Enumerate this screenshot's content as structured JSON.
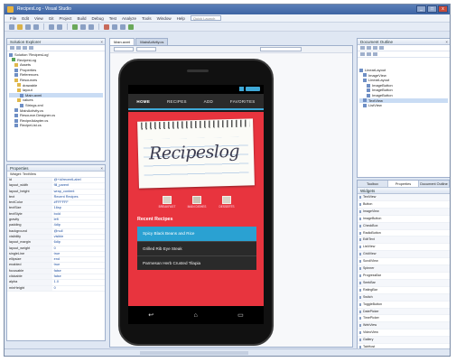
{
  "window": {
    "title": "RecipesLog - Visual Studio"
  },
  "menu": {
    "items": [
      "File",
      "Edit",
      "View",
      "Git",
      "Project",
      "Build",
      "Debug",
      "Test",
      "Analyze",
      "Tools",
      "Window",
      "Help"
    ],
    "quick_launch": "Quick Launch"
  },
  "solution_explorer": {
    "title": "Solution Explorer",
    "items": [
      "Solution 'RecipesLog'",
      "RecipesLog",
      "Assets",
      "Properties",
      "References",
      "Resources",
      "drawable",
      "layout",
      "Main.axml",
      "values",
      "Strings.xml",
      "MainActivity.cs",
      "Resource.Designer.cs",
      "RecipeAdapter.cs",
      "RecipeList.cs"
    ]
  },
  "properties": {
    "title": "Properties",
    "subtitle": "Widget: TextView",
    "rows": [
      [
        "id",
        "@+id/recentLabel"
      ],
      [
        "layout_width",
        "fill_parent"
      ],
      [
        "layout_height",
        "wrap_content"
      ],
      [
        "text",
        "Recent Recipes"
      ],
      [
        "textColor",
        "#FFFFFF"
      ],
      [
        "textSize",
        "16sp"
      ],
      [
        "textStyle",
        "bold"
      ],
      [
        "gravity",
        "left"
      ],
      [
        "padding",
        "4dip"
      ],
      [
        "background",
        "@null"
      ],
      [
        "visibility",
        "visible"
      ],
      [
        "layout_margin",
        "6dip"
      ],
      [
        "layout_weight",
        "0"
      ],
      [
        "singleLine",
        "true"
      ],
      [
        "ellipsize",
        "end"
      ],
      [
        "enabled",
        "true"
      ],
      [
        "focusable",
        "false"
      ],
      [
        "clickable",
        "false"
      ],
      [
        "alpha",
        "1.0"
      ],
      [
        "minHeight",
        "0"
      ]
    ]
  },
  "designer": {
    "tabs": [
      "Main.axml",
      "MainActivity.cs"
    ],
    "device": "Nexus 4",
    "app": {
      "nav": [
        "HOME",
        "RECIPES",
        "ADD",
        "FAVORITES"
      ],
      "logo": "Recipeslog",
      "categories": [
        "BREAKFAST",
        "MAIN DISHES",
        "DESSERTS"
      ],
      "recent_label": "Recent Recipes",
      "recipes": [
        "Spicy Black Beans and Rice",
        "Grilled Rib Eye Steak",
        "Parmesan Herb Crusted Tilapia"
      ],
      "navbar": [
        "back-arrow",
        "home",
        "recent-apps"
      ]
    }
  },
  "right_panel": {
    "title": "Document Outline",
    "tree": [
      "LinearLayout",
      "ImageView",
      "LinearLayout",
      "ImageButton",
      "ImageButton",
      "ImageButton",
      "TextView",
      "ListView"
    ],
    "tabs": [
      "Toolbox",
      "Properties",
      "Document Outline"
    ],
    "toolbox_header": "Widgets",
    "toolbox_items": [
      "TextView",
      "Button",
      "ImageView",
      "ImageButton",
      "CheckBox",
      "RadioButton",
      "EditText",
      "ListView",
      "GridView",
      "ScrollView",
      "Spinner",
      "ProgressBar",
      "SeekBar",
      "RatingBar",
      "Switch",
      "ToggleButton",
      "DatePicker",
      "TimePicker",
      "WebView",
      "VideoView",
      "Gallery",
      "TabHost"
    ]
  }
}
